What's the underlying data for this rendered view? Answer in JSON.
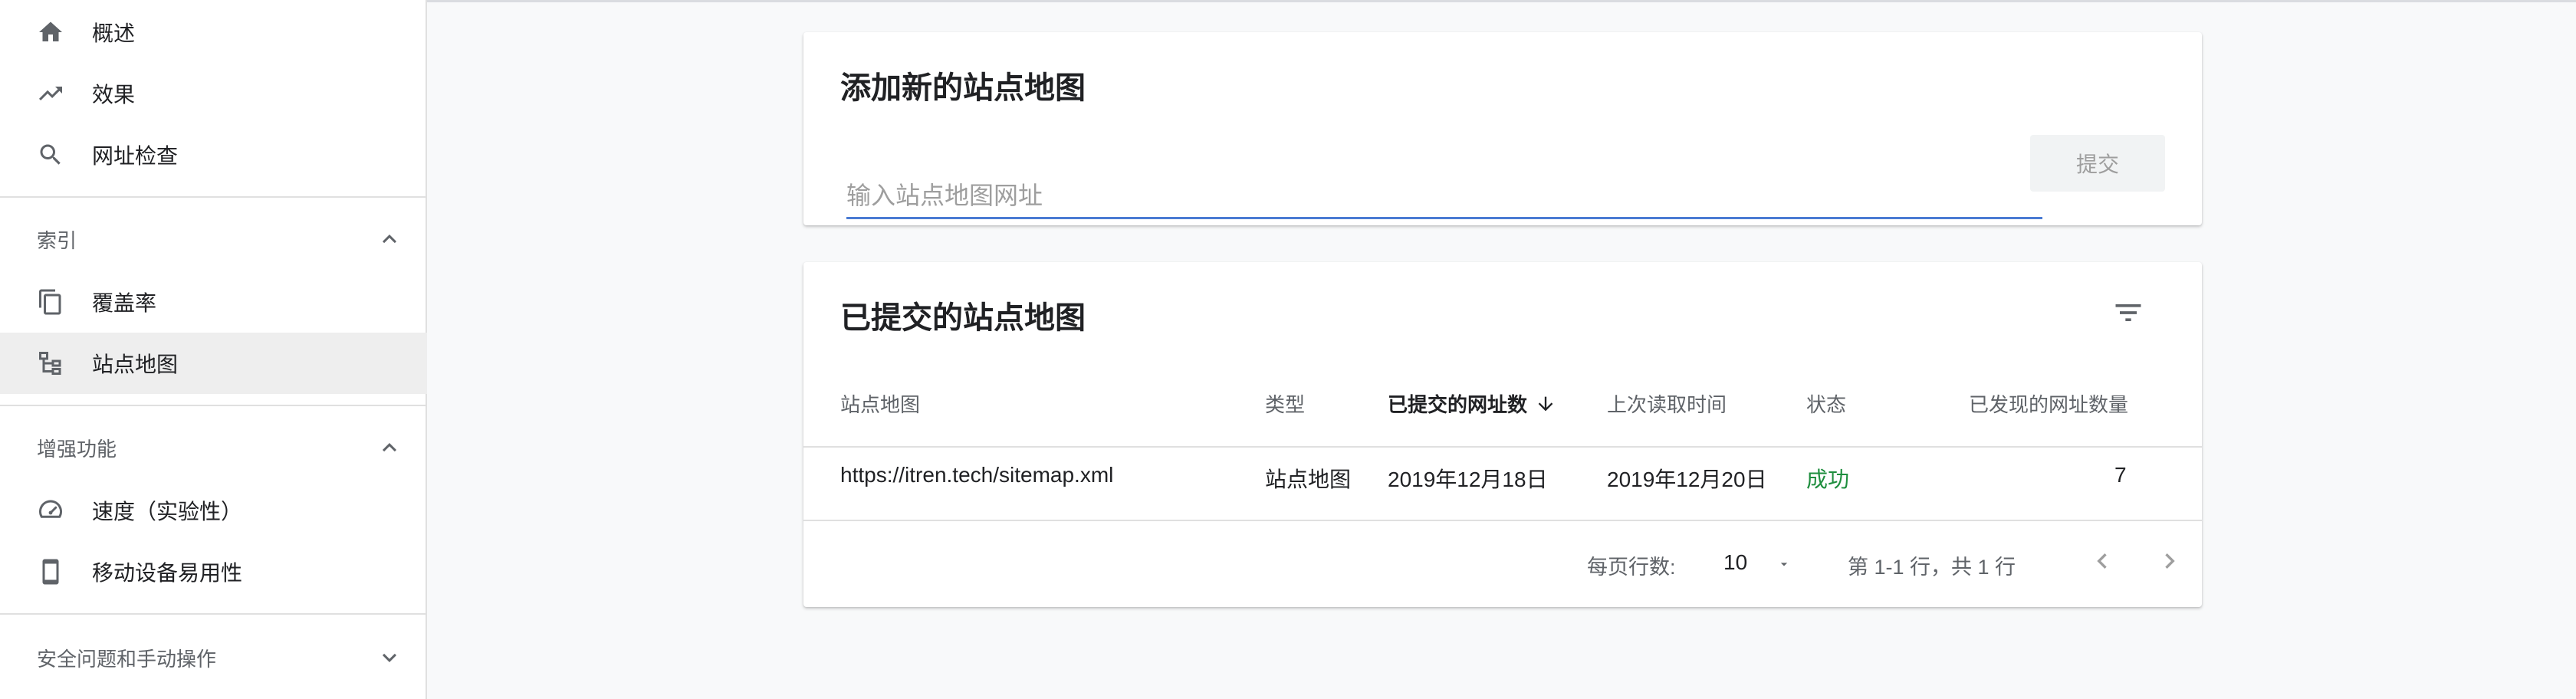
{
  "sidebar": {
    "items_top": [
      {
        "label": "概述",
        "icon": "home-icon"
      },
      {
        "label": "效果",
        "icon": "trending-up-icon"
      },
      {
        "label": "网址检查",
        "icon": "search-icon"
      }
    ],
    "sections": [
      {
        "title": "索引",
        "expanded": true,
        "items": [
          {
            "label": "覆盖率",
            "icon": "copy-pages-icon"
          },
          {
            "label": "站点地图",
            "icon": "sitemap-icon",
            "active": true
          }
        ]
      },
      {
        "title": "增强功能",
        "expanded": true,
        "items": [
          {
            "label": "速度（实验性）",
            "icon": "speedometer-icon"
          },
          {
            "label": "移动设备易用性",
            "icon": "smartphone-icon"
          }
        ]
      },
      {
        "title": "安全问题和手动操作",
        "expanded": false,
        "items": []
      }
    ]
  },
  "add_sitemap": {
    "title": "添加新的站点地图",
    "input_value": "",
    "input_placeholder": "输入站点地图网址",
    "submit_label": "提交"
  },
  "submitted": {
    "title": "已提交的站点地图",
    "columns": [
      "站点地图",
      "类型",
      "已提交的网址数",
      "上次读取时间",
      "状态",
      "已发现的网址数量"
    ],
    "sorted_column": "已提交的网址数",
    "sort_direction": "descending",
    "rows": [
      {
        "sitemap": "https://itren.tech/sitemap.xml",
        "type": "站点地图",
        "submitted": "2019年12月18日",
        "last_read": "2019年12月20日",
        "status": "成功",
        "discovered": "7"
      }
    ],
    "pagination": {
      "rows_per_page_label": "每页行数:",
      "rows_per_page": "10",
      "range": "第 1-1 行，共 1 行"
    }
  },
  "colors": {
    "accent": "#4a7bd3",
    "success": "#1e8e3e",
    "active_bg": "#eeeeee",
    "page_bg": "#f8f9fa"
  }
}
